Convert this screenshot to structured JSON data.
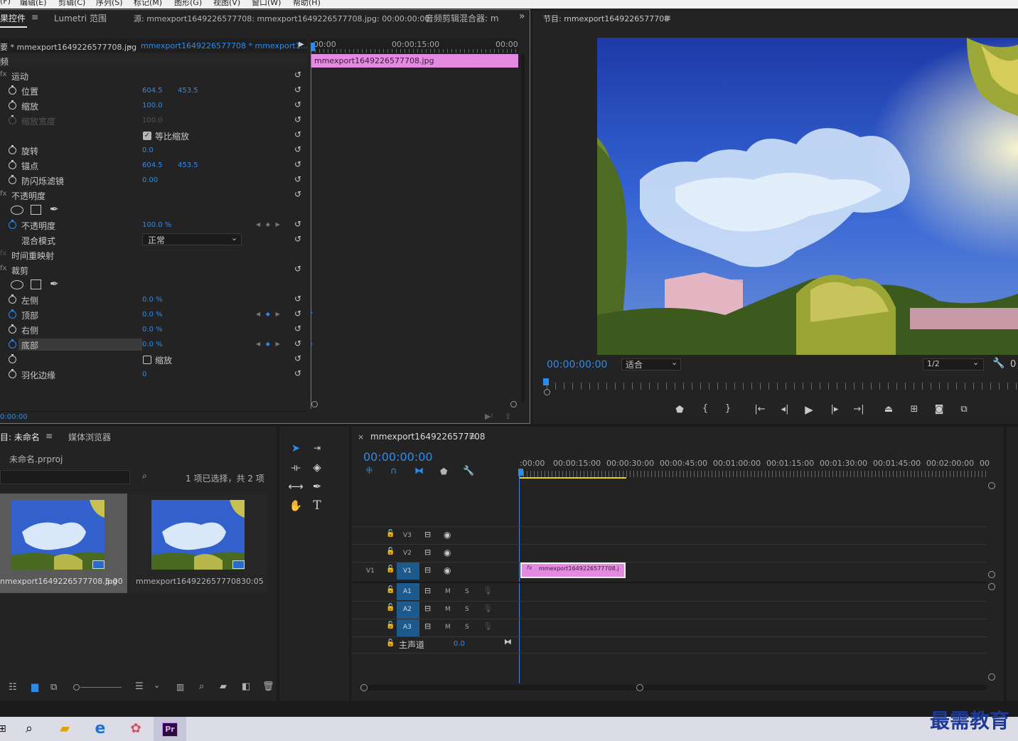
{
  "menu": [
    "(F)",
    "编辑(E)",
    "剪辑(C)",
    "序列(S)",
    "标记(M)",
    "图形(G)",
    "视图(V)",
    "窗口(W)",
    "帮助(H)"
  ],
  "effect_controls": {
    "tabs": [
      "果控件",
      "Lumetri 范围",
      "源: mmexport1649226577708: mmexport1649226577708.jpg: 00:00:00:00",
      "音频剪辑混合器: m"
    ],
    "tab_menu": "≡",
    "source_clip": "要 * mmexport1649226577708.jpg",
    "seq_clip": "mmexport1649226577708 * mmexport1...",
    "section": "频",
    "motion": "运动",
    "position_label": "位置",
    "position_x": "604.5",
    "position_y": "453.5",
    "scale_label": "缩放",
    "scale_val": "100.0",
    "scale_width_label": "缩放宽度",
    "scale_width_val": "100.0",
    "uniform_label": "等比缩放",
    "rotation_label": "旋转",
    "rotation_val": "0.0",
    "anchor_label": "锚点",
    "anchor_x": "604.5",
    "anchor_y": "453.5",
    "flicker_label": "防闪烁滤镜",
    "flicker_val": "0.00",
    "opacity_group": "不透明度",
    "opacity_label": "不透明度",
    "opacity_val": "100.0 %",
    "blend_label": "混合模式",
    "blend_val": "正常",
    "time_remap": "时间重映射",
    "crop": "裁剪",
    "left_label": "左侧",
    "left_val": "0.0 %",
    "top_label": "顶部",
    "top_val": "0.0 %",
    "right_label": "右侧",
    "right_val": "0.0 %",
    "bottom_label": "底部",
    "bottom_val": "0.0 %",
    "zoom_label": "缩放",
    "feather_label": "羽化边缘",
    "feather_val": "0",
    "timecode": "0:00:00",
    "ruler": [
      "00:00",
      "00:00:15:00",
      "00:00"
    ],
    "clip_name": "mmexport1649226577708.jpg"
  },
  "program": {
    "title": "节目: mmexport1649226577708",
    "timecode": "00:00:00:00",
    "fit": "适合",
    "quality": "1/2",
    "extra": "0"
  },
  "project": {
    "tab": "目: 未命名",
    "tab2": "媒体浏览器",
    "file": "未命名.prproj",
    "status": "1 项已选择，共 2 项",
    "items": [
      {
        "name": "nmexport1649226577708.jpg",
        "dur": "5:00"
      },
      {
        "name": "mmexport1649226577708",
        "dur": "30:05"
      }
    ]
  },
  "timeline": {
    "tab": "mmexport1649226577708",
    "timecode": "00:00:00:00",
    "ruler": [
      ":00:00",
      "00:00:15:00",
      "00:00:30:00",
      "00:00:45:00",
      "00:01:00:00",
      "00:01:15:00",
      "00:01:30:00",
      "00:01:45:00",
      "00:02:00:00",
      "00"
    ],
    "tracks": [
      "V3",
      "V2",
      "V1",
      "A1",
      "A2",
      "A3"
    ],
    "src_v1": "V1",
    "master": "主声道",
    "master_val": "0.0",
    "m": "M",
    "s": "S",
    "clip": "mmexport1649226577708.j",
    "fx": "fx"
  },
  "watermark": "最需教育"
}
